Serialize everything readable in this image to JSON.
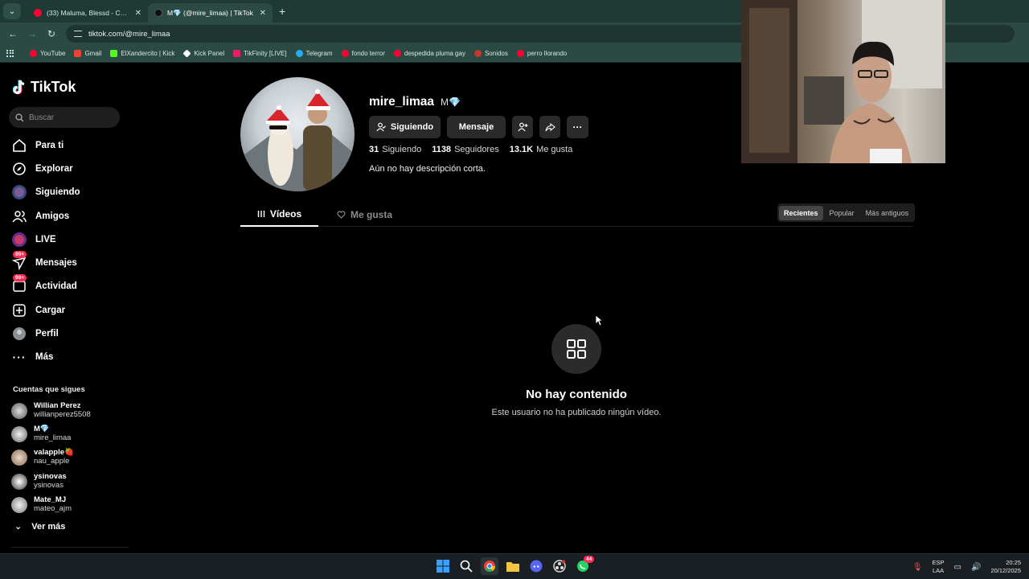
{
  "browser": {
    "tabs": [
      {
        "title": "(33) Maluma, Blessd - Call Me (",
        "favicon_color": "#ff0033",
        "active": false
      },
      {
        "title": "M💎 (@mire_limaa) | TikTok",
        "favicon_color": "#000000",
        "active": true
      }
    ],
    "url": "tiktok.com/@mire_limaa",
    "bookmarks": [
      {
        "label": "YouTube",
        "icon": "youtube-icon",
        "color": "#ff0033"
      },
      {
        "label": "Gmail",
        "icon": "gmail-icon",
        "color": "#ea4335"
      },
      {
        "label": "ElXandercito | Kick",
        "icon": "kick-icon",
        "color": "#53fc18"
      },
      {
        "label": "Kick Panel",
        "icon": "diamond-icon",
        "color": "#ffffff"
      },
      {
        "label": "TikFinity [LIVE]",
        "icon": "tikfinity-icon",
        "color": "#e91e63"
      },
      {
        "label": "Telegram",
        "icon": "telegram-icon",
        "color": "#2aabee"
      },
      {
        "label": "fondo terror",
        "icon": "youtube-icon",
        "color": "#ff0033"
      },
      {
        "label": "despedida pluma gay",
        "icon": "youtube-icon",
        "color": "#ff0033"
      },
      {
        "label": "Sonidos",
        "icon": "red-circle-icon",
        "color": "#c0392b"
      },
      {
        "label": "perro llorando",
        "icon": "youtube-icon",
        "color": "#ff0033"
      }
    ]
  },
  "sidebar": {
    "logo": "TikTok",
    "search_placeholder": "Buscar",
    "nav": [
      {
        "label": "Para ti",
        "icon": "home-icon"
      },
      {
        "label": "Explorar",
        "icon": "compass-icon"
      },
      {
        "label": "Siguiendo",
        "icon": "following-icon"
      },
      {
        "label": "Amigos",
        "icon": "friends-icon"
      },
      {
        "label": "LIVE",
        "icon": "live-icon"
      },
      {
        "label": "Mensajes",
        "icon": "messages-icon",
        "badge": "99+"
      },
      {
        "label": "Actividad",
        "icon": "activity-icon",
        "badge": "99+"
      },
      {
        "label": "Cargar",
        "icon": "upload-icon"
      },
      {
        "label": "Perfil",
        "icon": "profile-icon"
      },
      {
        "label": "Más",
        "icon": "more-icon"
      }
    ],
    "following_title": "Cuentas que sigues",
    "following": [
      {
        "name": "Willian Perez",
        "handle": "willianperez5508"
      },
      {
        "name": "M💎",
        "handle": "mire_limaa"
      },
      {
        "name": "valapple🍓",
        "handle": "nau_apple"
      },
      {
        "name": "ysinovas",
        "handle": "ysinovas"
      },
      {
        "name": "Mate_MJ",
        "handle": "mateo_ajm"
      }
    ],
    "see_more": "Ver más"
  },
  "profile": {
    "username": "mire_limaa",
    "nickname": "M💎",
    "buttons": {
      "following": "Siguiendo",
      "message": "Mensaje"
    },
    "stats": {
      "following_count": "31",
      "following_label": "Siguiendo",
      "followers_count": "1138",
      "followers_label": "Seguidores",
      "likes_count": "13.1K",
      "likes_label": "Me gusta"
    },
    "bio": "Aún no hay descripción corta.",
    "tabs": {
      "videos": "Vídeos",
      "likes": "Me gusta"
    },
    "sort": [
      "Recientes",
      "Popular",
      "Más antiguos"
    ],
    "sort_selected": "Recientes",
    "empty_title": "No hay contenido",
    "empty_subtitle": "Este usuario no ha publicado ningún vídeo."
  },
  "taskbar": {
    "lang": "ESP",
    "layout": "LAA",
    "time": "20:25",
    "date": "20/12/2025",
    "whatsapp_badge": "44"
  },
  "colors": {
    "accent": "#fe2c55",
    "background": "#000000"
  }
}
